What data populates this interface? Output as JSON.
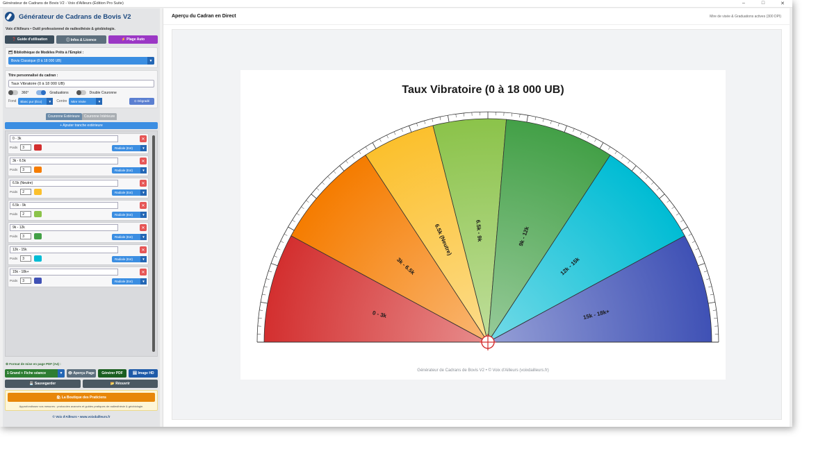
{
  "window": {
    "title": "Générateur de Cadrans de Bovis V2 - Voix d'Ailleurs (Édition Pro Suite)",
    "controls": [
      "–",
      "□",
      "✕"
    ]
  },
  "sidebar": {
    "app_title": "Générateur de Cadrans de Bovis V2",
    "subtitle": "Voix d'Ailleurs • Outil professionnel de radiesthésie & géobiologie.",
    "buttons": [
      {
        "label": "❓ Guide d'utilisation",
        "color": "#3c4e5c"
      },
      {
        "label": "ⓘ Infos & Licence",
        "color": "#5d6f7d"
      },
      {
        "label": "⚡ Plage Auto",
        "color": "#9b37c5"
      }
    ],
    "library_label": "🗂 Bibliothèque de Modèles Prêts à l'Emploi :",
    "library_value": "Bovis Classique (0 à 18 000 UB)",
    "title_label": "Titre personnalisé du cadran :",
    "title_value": "Taux Vibratoire (0 à 18 000 UB)",
    "toggles": [
      {
        "label": "360°",
        "on": false
      },
      {
        "label": "Graduations",
        "on": true
      },
      {
        "label": "Double Couronne",
        "on": false
      }
    ],
    "fond_label": "Fond",
    "fond_value": "Blanc pur (Éco)",
    "centre_label": "Centre",
    "centre_value": "Mire Visée",
    "degrade_label": "⊙ Dégradé",
    "tab_outer": "Couronne Extérieure",
    "tab_inner": "Couronne Intérieure",
    "add_label": "+ Ajouter tranche extérieure",
    "poids_label": "Poids",
    "radiale_label": "Radiale (Ext)",
    "slices": [
      {
        "name": "0 - 3k",
        "weight": "3",
        "color": "#d32f2f"
      },
      {
        "name": "3k - 6.5k",
        "weight": "3",
        "color": "#f57c00"
      },
      {
        "name": "6.5k (Neutre)",
        "weight": "2",
        "color": "#fbc02d"
      },
      {
        "name": "6.5k - 9k",
        "weight": "2",
        "color": "#8bc34a"
      },
      {
        "name": "9k - 12k",
        "weight": "3",
        "color": "#43a047"
      },
      {
        "name": "12k - 15k",
        "weight": "3",
        "color": "#00bcd4"
      },
      {
        "name": "15k - 18k+",
        "weight": "3",
        "color": "#3f51b5"
      }
    ],
    "format_label": "⚙ Format de mise en page PDF (A4) :",
    "format_value": "1 Grand + Fiche séance",
    "apercu_label": "👁 Aperçu Page",
    "pdf_label": "Générer PDF",
    "image_label": "🖼 Image HD",
    "save_label": "💾 Sauvegarder",
    "open_label": "📂 Réouvrir",
    "shop_label": "🛍 La Boutique des Praticiens",
    "shop_text": "Approfondissez vos mesures : protocoles avancés et guides pratiques de radiesthésie & géobiologie.",
    "footer": "© Voix d'Ailleurs • www.voixdailleurs.fr"
  },
  "main": {
    "title": "Aperçu du Cadran en Direct",
    "status": "Mire de visée & Graduations actives (300 DPI)",
    "credit": "Générateur de Cadrans de Bovis V2 • © Voix d'Ailleurs (voixdailleurs.fr)"
  },
  "chart_data": {
    "type": "pie",
    "title": "Taux Vibratoire (0 à 18 000 UB)",
    "layout": "semicircle",
    "categories": [
      "0 - 3k",
      "3k - 6.5k",
      "6.5k (Neutre)",
      "6.5k - 9k",
      "9k - 12k",
      "12k - 15k",
      "15k - 18k+"
    ],
    "values": [
      3,
      3,
      2,
      2,
      3,
      3,
      3
    ],
    "colors": [
      "#d32f2f",
      "#f57c00",
      "#fbc02d",
      "#8bc34a",
      "#43a047",
      "#00bcd4",
      "#3f51b5"
    ],
    "graduations": true,
    "center": "crosshair"
  }
}
